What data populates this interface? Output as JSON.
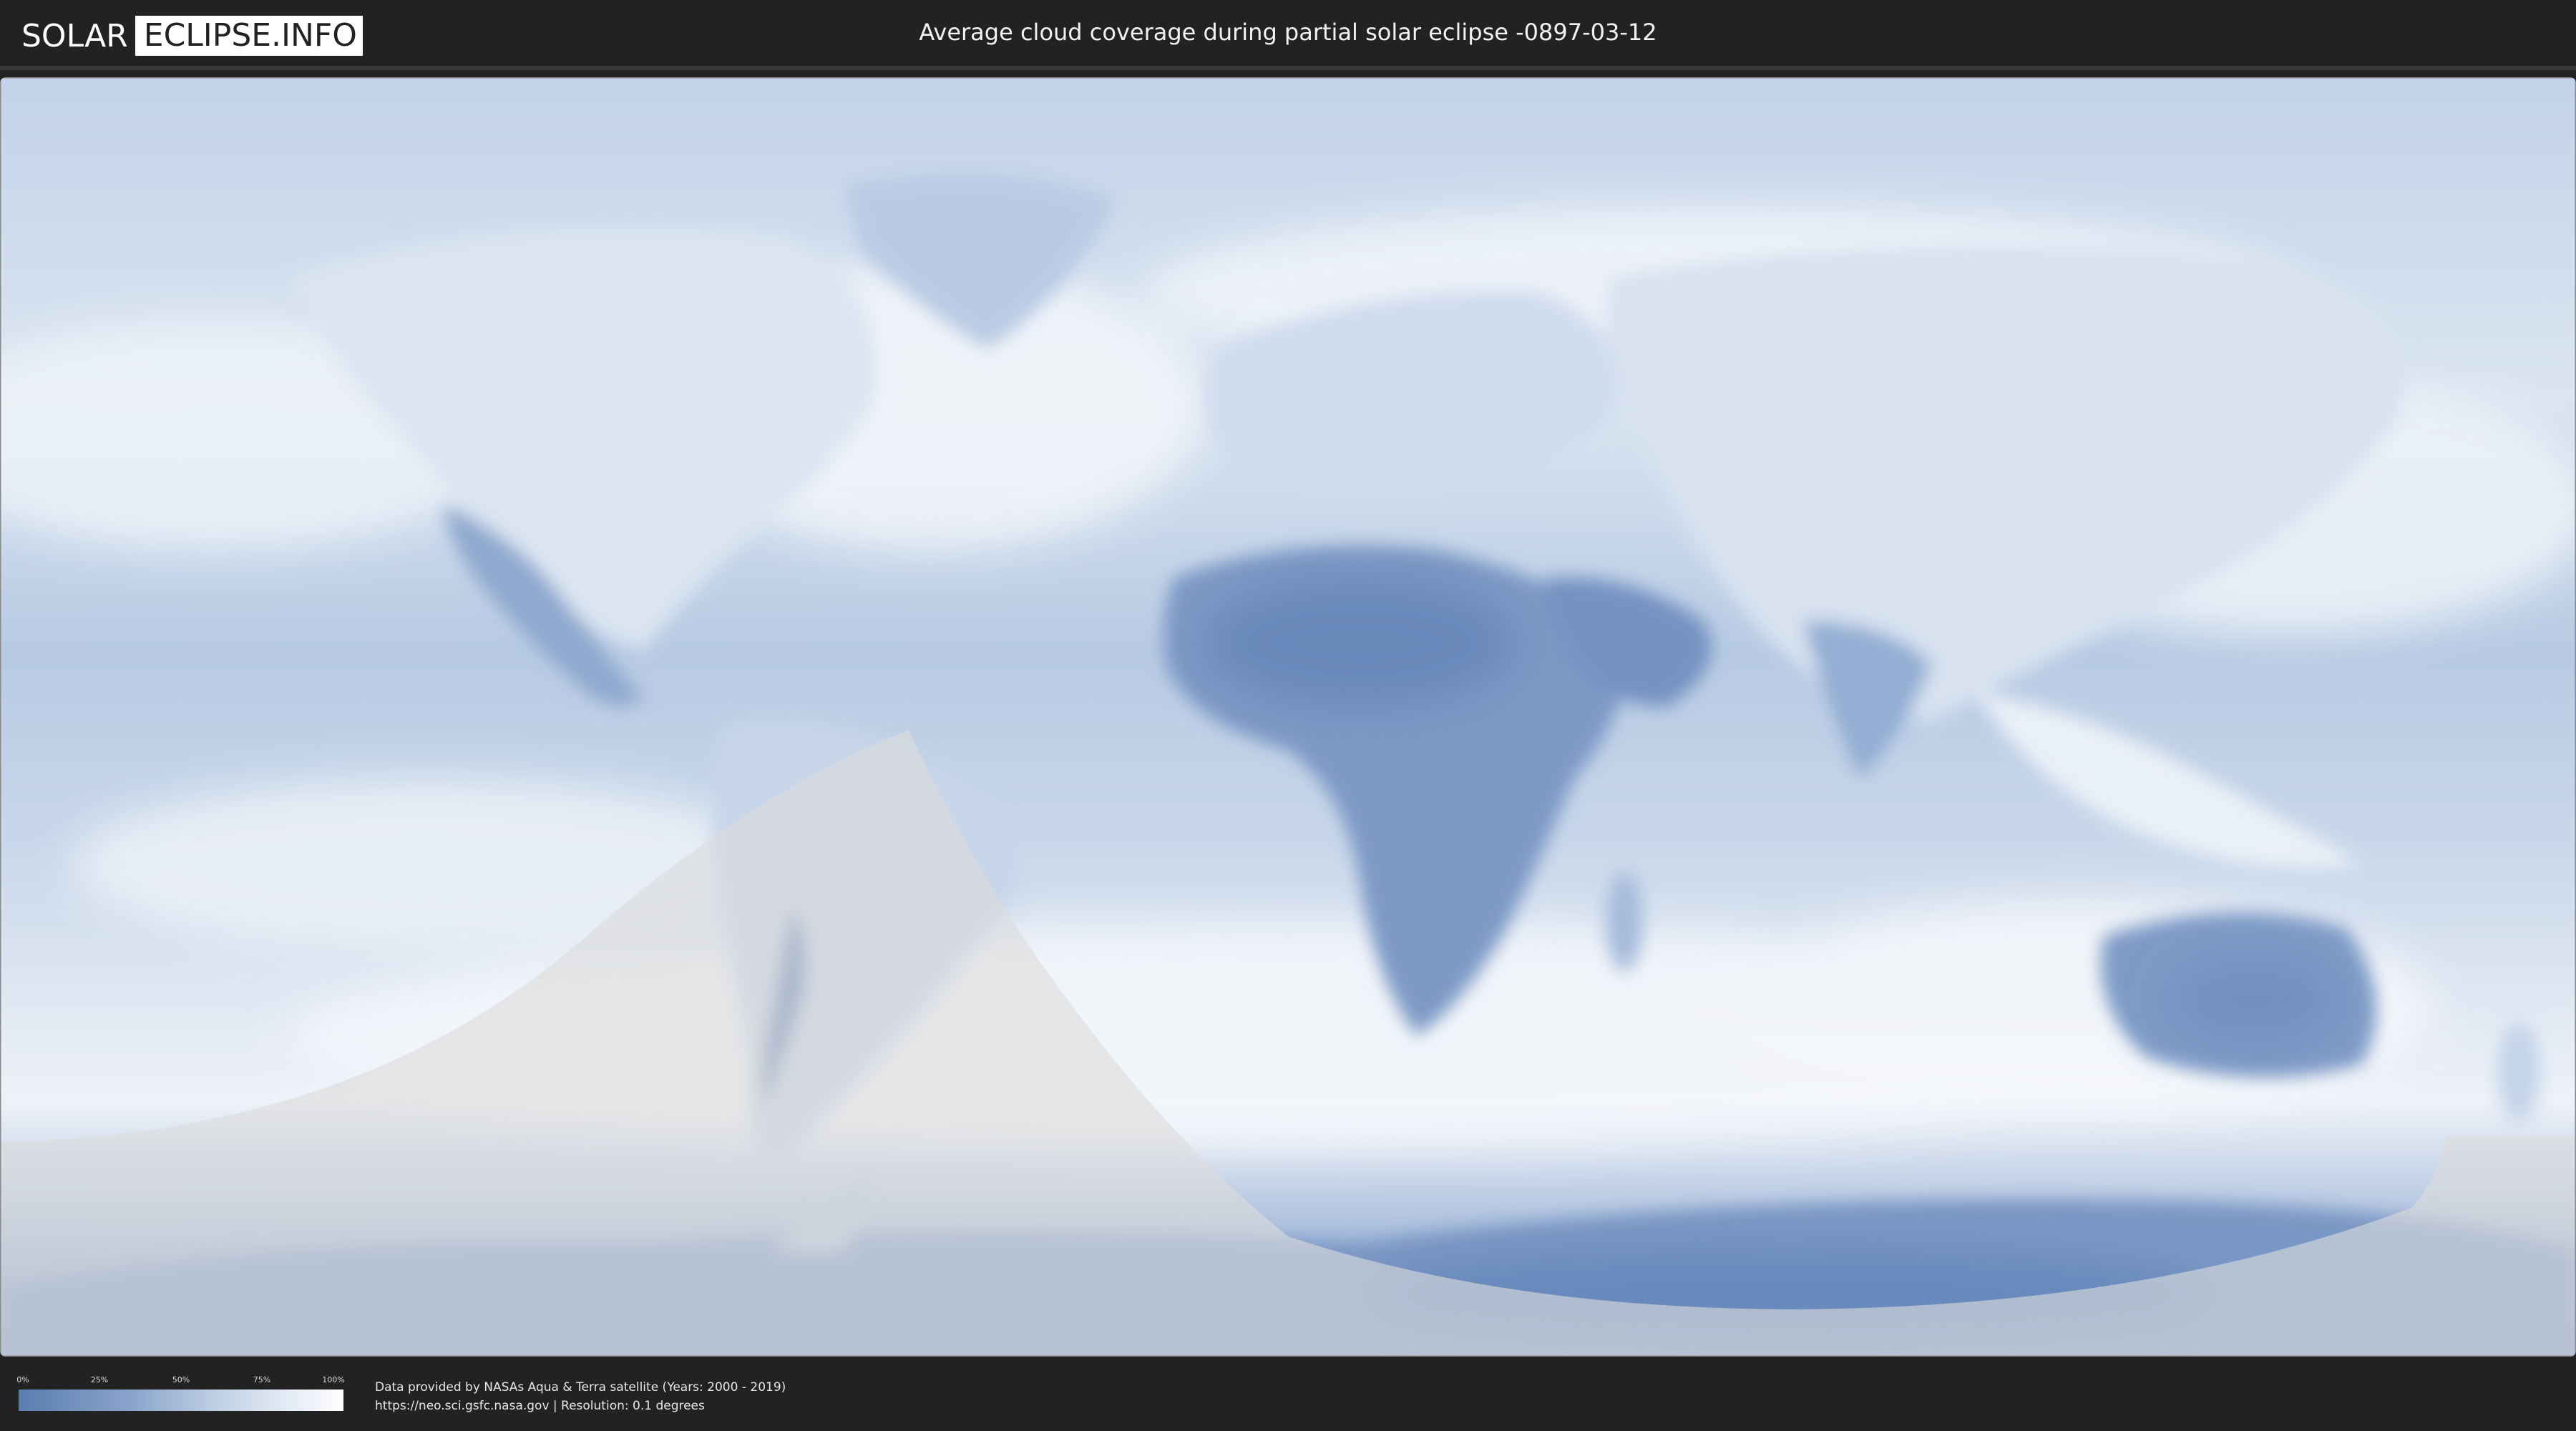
{
  "header": {
    "logo_part1": "SOLAR",
    "logo_part2": "ECLIPSE.INFO",
    "title": "Average cloud coverage during partial solar eclipse -0897-03-12"
  },
  "legend": {
    "ticks": [
      "0%",
      "25%",
      "50%",
      "75%",
      "100%"
    ],
    "gradient_colors": [
      "#5a7db0",
      "#8aa5cb",
      "#c7d5e8",
      "#ffffff"
    ]
  },
  "footer": {
    "credit_line1": "Data provided by NASAs Aqua & Terra satellite (Years: 2000 - 2019)",
    "credit_line2": "https://neo.sci.gsfc.nasa.gov | Resolution: 0.1 degrees"
  },
  "map": {
    "projection": "equirectangular",
    "ocean_base_color": "#a9bfdd",
    "cloud_color": "#f4f7fb",
    "dry_land_color": "#6f8fbe",
    "eclipse_shadow_color": "#d8d8d8"
  }
}
